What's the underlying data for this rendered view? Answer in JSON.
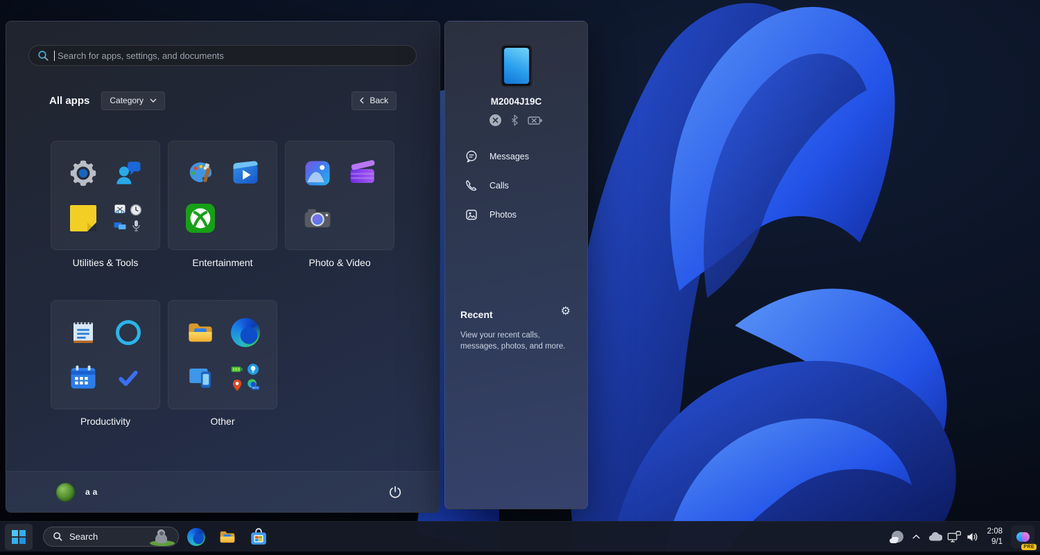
{
  "wallpaper": {
    "style": "windows-11-dark-bloom",
    "base_color": "#070b16",
    "bloom_colors": [
      "#5b95f7",
      "#2353e8",
      "#0e2390",
      "#0a1658"
    ]
  },
  "start_menu": {
    "search_placeholder": "Search for apps, settings, and documents",
    "all_apps_label": "All apps",
    "category_button_label": "Category",
    "back_button_label": "Back",
    "categories": [
      {
        "label": "Utilities & Tools",
        "icons": [
          "settings-gear",
          "get-help-person-chat",
          "sticky-notes",
          "snipping-tool",
          "clock-alarms",
          "quick-assist",
          "voice-recorder"
        ]
      },
      {
        "label": "Entertainment",
        "icons": [
          "paint-palette",
          "media-player",
          "xbox"
        ]
      },
      {
        "label": "Photo & Video",
        "icons": [
          "photos",
          "clipchamp",
          "camera"
        ]
      },
      {
        "label": "Productivity",
        "icons": [
          "notepad",
          "cortana-ring",
          "calendar",
          "todo-check"
        ]
      },
      {
        "label": "Other",
        "icons": [
          "file-explorer",
          "microsoft-edge",
          "phone-link",
          "battery",
          "tips-bulb",
          "maps-pin",
          "edge-beta"
        ]
      }
    ],
    "user_name": "a a"
  },
  "phone_panel": {
    "device_name": "M2004J19C",
    "status_icons": [
      "connection-off-circle-x",
      "bluetooth",
      "battery-unknown-x"
    ],
    "menu": [
      {
        "label": "Messages"
      },
      {
        "label": "Calls"
      },
      {
        "label": "Photos"
      }
    ],
    "recent_title": "Recent",
    "recent_description": "View your recent calls, messages, photos, and more.",
    "icons": {
      "gear_glyph": "⚙"
    }
  },
  "taskbar": {
    "search_label": "Search",
    "time": "2:08",
    "date": "9/1",
    "copilot_badge": "PRE",
    "pinned": [
      "start",
      "search",
      "microsoft-edge",
      "file-explorer",
      "microsoft-store"
    ],
    "tray_icons": [
      "weather-moon-cloud",
      "hidden-icons-chevron",
      "onedrive-cloud",
      "network-display",
      "volume",
      "clock",
      "copilot-preview"
    ]
  }
}
